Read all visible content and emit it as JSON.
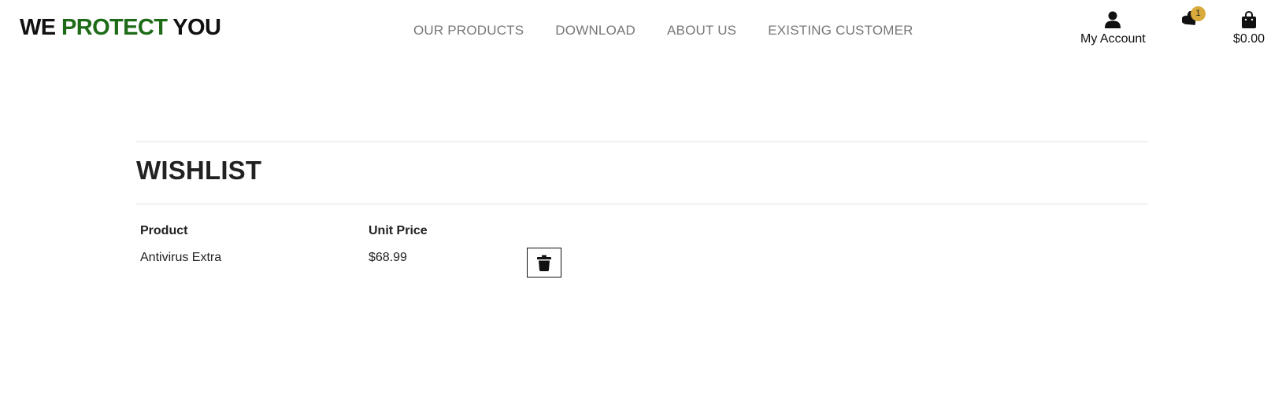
{
  "header": {
    "logo": {
      "part1": "WE",
      "part2": "PROTECT",
      "part3": "YOU"
    },
    "nav": [
      "OUR PRODUCTS",
      "DOWNLOAD",
      "ABOUT US",
      "EXISTING CUSTOMER"
    ],
    "account": {
      "label": "My Account",
      "icon": "user-icon"
    },
    "wishlist": {
      "count": "1",
      "icon": "heart-tag-icon"
    },
    "bag": {
      "total": "$0.00",
      "icon": "shopping-bag-icon"
    }
  },
  "page": {
    "title": "WISHLIST"
  },
  "table": {
    "headers": [
      "Product",
      "Unit Price"
    ],
    "rows": [
      {
        "product": "Antivirus Extra",
        "price": "$68.99",
        "action_icon": "trash-icon"
      }
    ]
  },
  "colors": {
    "brand_green": "#1e6b17",
    "badge": "#d9a93a",
    "nav_text": "#777777"
  }
}
